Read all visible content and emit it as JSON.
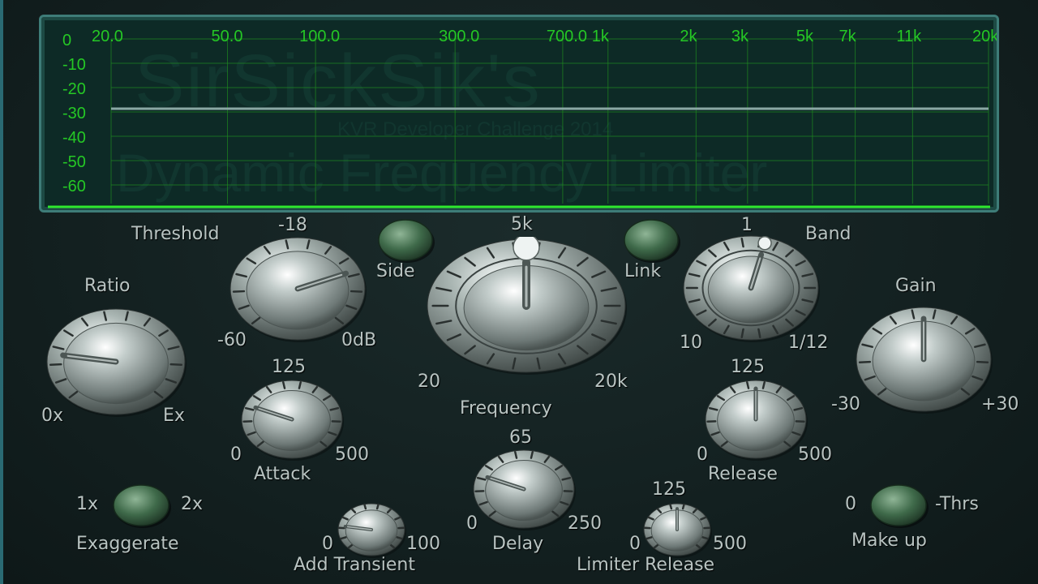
{
  "display": {
    "freq_labels": [
      "20.0",
      "50.0",
      "100.0",
      "300.0",
      "700.0",
      "1k",
      "2k",
      "3k",
      "5k",
      "7k",
      "11k",
      "20k"
    ],
    "db_labels": [
      "0",
      "-10",
      "-20",
      "-30",
      "-40",
      "-50",
      "-60"
    ],
    "watermark": {
      "line1": "SirSickSik's",
      "line2": "KVR Developer Challenge 2014",
      "line3": "Dynamic Frequency Limiter"
    },
    "threshold_db": -30,
    "colors": {
      "grid": "#1f8a1f",
      "text": "#25c825",
      "threshold_line": "#8aa8a4"
    }
  },
  "controls": {
    "threshold": {
      "label": "Threshold",
      "top": "-18",
      "min": "-60",
      "max": "0dB",
      "value_fraction": 0.75
    },
    "ratio": {
      "label": "Ratio",
      "min": "0x",
      "max": "Ex",
      "value_fraction": 0.2
    },
    "side": {
      "label": "Side"
    },
    "link": {
      "label": "Link"
    },
    "frequency": {
      "label": "Frequency",
      "top": "5k",
      "min": "20",
      "max": "20k",
      "value_fraction": 0.5
    },
    "band": {
      "label": "Band",
      "top": "1",
      "min": "10",
      "max": "1/12",
      "value_fraction": 0.55
    },
    "gain": {
      "label": "Gain",
      "min": "-30",
      "max": "+30",
      "value_fraction": 0.5
    },
    "attack": {
      "label": "Attack",
      "top": "125",
      "min": "0",
      "max": "500",
      "value_fraction": 0.25
    },
    "release": {
      "label": "Release",
      "top": "125",
      "min": "0",
      "max": "500",
      "value_fraction": 0.5
    },
    "exaggerate": {
      "label": "Exaggerate",
      "left": "1x",
      "right": "2x"
    },
    "add_transient": {
      "label": "Add Transient",
      "min": "0",
      "max": "100",
      "value_fraction": 0.2
    },
    "delay": {
      "label": "Delay",
      "top": "65",
      "min": "0",
      "max": "250",
      "value_fraction": 0.25
    },
    "limiter_release": {
      "label": "Limiter Release",
      "top": "125",
      "min": "0",
      "max": "500",
      "value_fraction": 0.5
    },
    "makeup": {
      "label": "Make up",
      "left": "0",
      "right": "-Thrs"
    }
  }
}
